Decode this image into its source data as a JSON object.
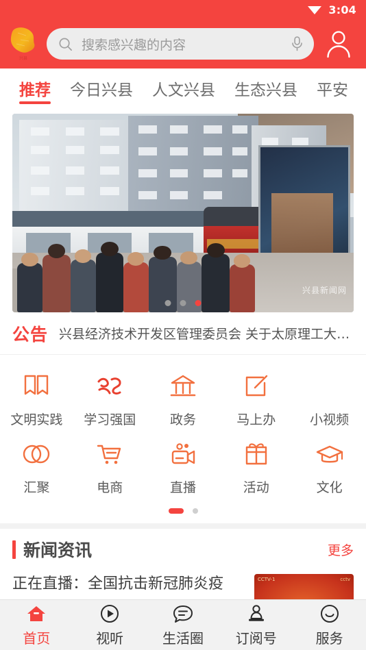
{
  "statusbar": {
    "time": "3:04",
    "wifi_icon": "wifi-icon"
  },
  "header": {
    "logo_icon": "xingxian-map-logo",
    "search": {
      "placeholder": "搜索感兴趣的内容",
      "value": "",
      "search_icon": "search-icon",
      "mic_icon": "microphone-icon"
    },
    "profile_icon": "user-profile-icon",
    "background_color": "#f4443f"
  },
  "tabs": [
    {
      "label": "推荐",
      "active": true
    },
    {
      "label": "今日兴县",
      "active": false
    },
    {
      "label": "人文兴县",
      "active": false
    },
    {
      "label": "生态兴县",
      "active": false
    },
    {
      "label": "平安",
      "active": false
    }
  ],
  "banner": {
    "watermark": "兴县新闻网",
    "dots": [
      {
        "active": false
      },
      {
        "active": false
      },
      {
        "active": true
      }
    ]
  },
  "notice": {
    "tag": "公告",
    "text": "兴县经济技术开发区管理委员会 关于太原理工大学..."
  },
  "icon_grid": {
    "rows": [
      [
        {
          "label": "文明实践",
          "icon": "open-book-icon"
        },
        {
          "label": "学习强国",
          "icon": "xuexi-calligraphy-icon"
        },
        {
          "label": "政务",
          "icon": "government-building-icon"
        },
        {
          "label": "马上办",
          "icon": "edit-square-icon"
        },
        {
          "label": "小视频",
          "icon": "short-video-icon"
        }
      ],
      [
        {
          "label": "汇聚",
          "icon": "two-circles-icon"
        },
        {
          "label": "电商",
          "icon": "shopping-cart-icon"
        },
        {
          "label": "直播",
          "icon": "video-camera-icon"
        },
        {
          "label": "活动",
          "icon": "gift-icon"
        },
        {
          "label": "文化",
          "icon": "graduation-cap-icon"
        }
      ]
    ],
    "page_dots": [
      {
        "active": true
      },
      {
        "active": false
      }
    ]
  },
  "news": {
    "section_title": "新闻资讯",
    "more_label": "更多",
    "items": [
      {
        "title": "正在直播：全国抗击新冠肺炎疫",
        "thumb_label_left": "CCTV-1",
        "thumb_label_right": "cctv"
      }
    ]
  },
  "bottom_nav": [
    {
      "label": "首页",
      "icon": "home-icon",
      "active": true
    },
    {
      "label": "视听",
      "icon": "play-circle-icon",
      "active": false
    },
    {
      "label": "生活圈",
      "icon": "chat-bubble-icon",
      "active": false
    },
    {
      "label": "订阅号",
      "icon": "stamp-icon",
      "active": false
    },
    {
      "label": "服务",
      "icon": "smiley-circle-icon",
      "active": false
    }
  ],
  "colors": {
    "brand_red": "#f4443f",
    "icon_orange": "#f2703f",
    "text_dark": "#3e3e3e",
    "text_gray": "#6e6e6e",
    "page_bg": "#f2f2f2"
  }
}
